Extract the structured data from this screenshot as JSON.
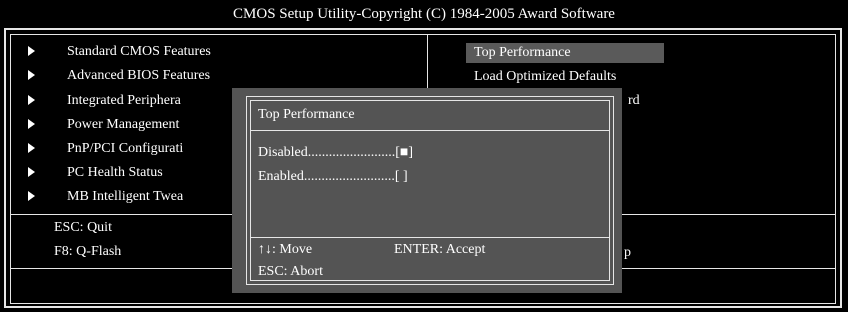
{
  "title": "CMOS Setup Utility-Copyright (C) 1984-2005 Award Software",
  "left_menu": [
    {
      "label": "Standard CMOS Features"
    },
    {
      "label": "Advanced BIOS Features"
    },
    {
      "label": "Integrated Periphera"
    },
    {
      "label": "Power Management"
    },
    {
      "label": "PnP/PCI Configurati"
    },
    {
      "label": "PC Health Status"
    },
    {
      "label": "MB Intelligent Twea"
    }
  ],
  "right_menu": [
    {
      "label": "Top Performance"
    },
    {
      "label": "Load Optimized Defaults"
    },
    {
      "label": "rd"
    }
  ],
  "help": {
    "esc": "ESC: Quit",
    "f8": "F8: Q-Flash",
    "right_fragment": "p"
  },
  "popup": {
    "title": "Top Performance",
    "options": [
      {
        "label": "Disabled.........................[■]"
      },
      {
        "label": "Enabled..........................[ ]"
      }
    ],
    "move": "↑↓: Move",
    "accept": "ENTER: Accept",
    "abort": "ESC: Abort"
  },
  "colors": {
    "background": "#000000",
    "foreground": "#ffffff",
    "highlight": "#5a5a5a",
    "popup_bg": "#545454"
  }
}
